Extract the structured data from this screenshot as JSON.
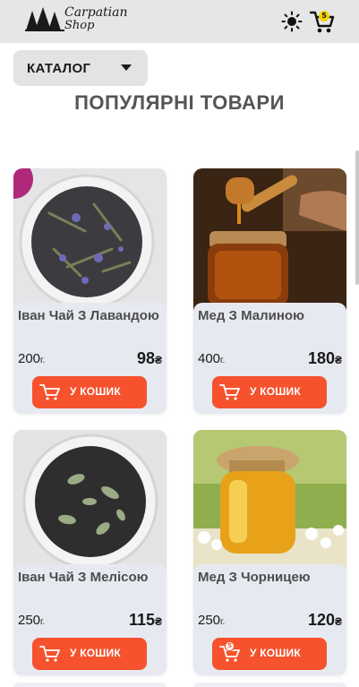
{
  "header": {
    "logo_line1": "Carpatian",
    "logo_line2": "Shop",
    "cart_count": "5"
  },
  "catalog": {
    "label": "КАТАЛОГ"
  },
  "section": {
    "title": "ПОПУЛЯРНІ ТОВАРИ"
  },
  "products": [
    {
      "name": "Іван Чай З Лавандою",
      "weight": "200",
      "weight_unit": "г.",
      "price": "98",
      "currency": "₴",
      "buy_label": "У КОШИК"
    },
    {
      "name": "Мед З Малиною",
      "weight": "400",
      "weight_unit": "г.",
      "price": "180",
      "currency": "₴",
      "buy_label": "У КОШИК"
    },
    {
      "name": "Іван Чай З Мелісою",
      "weight": "250",
      "weight_unit": "г.",
      "price": "115",
      "currency": "₴",
      "buy_label": "У КОШИК"
    },
    {
      "name": "Мед З Чорницею",
      "weight": "250",
      "weight_unit": "г.",
      "price": "120",
      "currency": "₴",
      "buy_label": "У КОШИК",
      "in_cart_count": "5"
    }
  ],
  "colors": {
    "header_bg": "#e6e6e6",
    "accent": "#f5522d",
    "card_bg": "#e6e9f0",
    "title": "#555555"
  }
}
